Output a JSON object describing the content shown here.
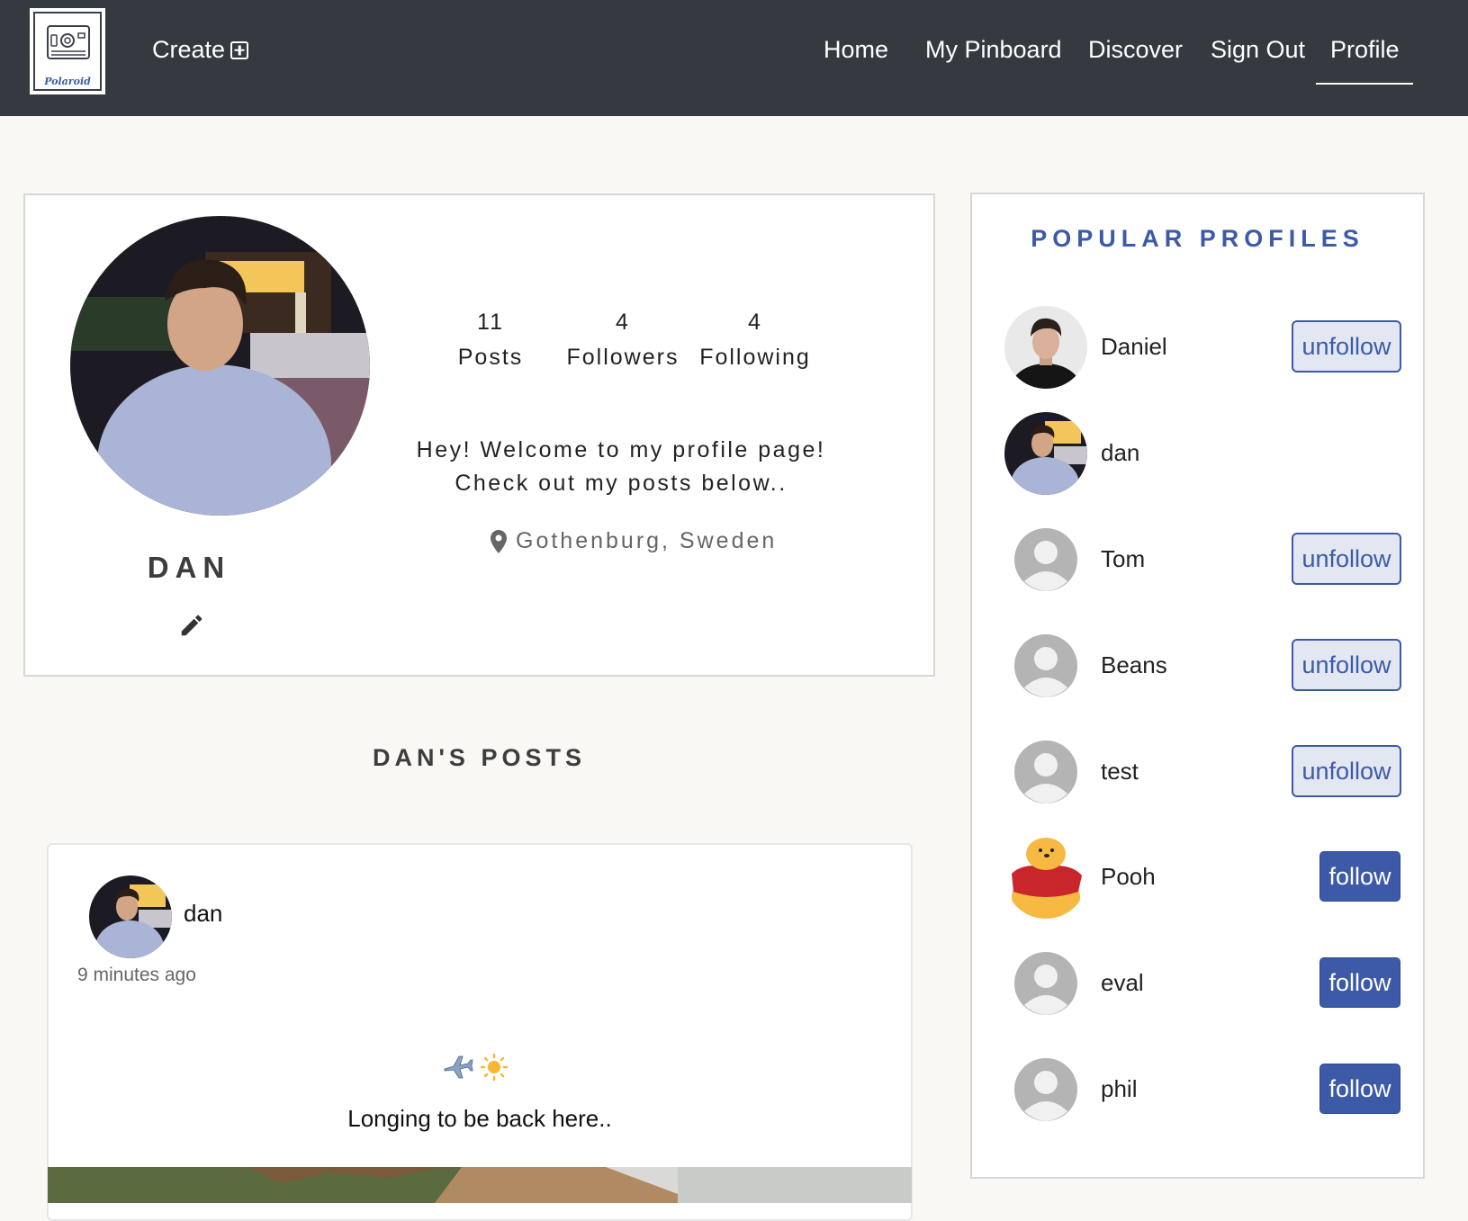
{
  "nav": {
    "logo_text": "Polaroid",
    "create_label": "Create",
    "links": [
      "Home",
      "My Pinboard",
      "Discover",
      "Sign Out",
      "Profile"
    ],
    "active": "Profile"
  },
  "profile": {
    "name": "DAN",
    "stats": [
      {
        "value": "11",
        "label": "Posts"
      },
      {
        "value": "4",
        "label": "Followers"
      },
      {
        "value": "4",
        "label": "Following"
      }
    ],
    "bio_line1": "Hey! Welcome to my profile page!",
    "bio_line2": "Check out my posts below..",
    "location": "Gothenburg, Sweden"
  },
  "posts_heading": "DAN'S POSTS",
  "post": {
    "author": "dan",
    "time": "9 minutes ago",
    "emoji": "✈️☀️",
    "text": "Longing to be back here.."
  },
  "popular": {
    "title": "POPULAR PROFILES",
    "profiles": [
      {
        "name": "Daniel",
        "action": "unfollow",
        "avatar": "photo-man"
      },
      {
        "name": "dan",
        "action": "",
        "avatar": "photo-dan"
      },
      {
        "name": "Tom",
        "action": "unfollow",
        "avatar": "default"
      },
      {
        "name": "Beans",
        "action": "unfollow",
        "avatar": "default"
      },
      {
        "name": "test",
        "action": "unfollow",
        "avatar": "default"
      },
      {
        "name": "Pooh",
        "action": "follow",
        "avatar": "pooh"
      },
      {
        "name": "eval",
        "action": "follow",
        "avatar": "default"
      },
      {
        "name": "phil",
        "action": "follow",
        "avatar": "default"
      }
    ]
  },
  "colors": {
    "navbar": "#343a40",
    "accent": "#3c5aa8",
    "background": "#f9f8f5"
  }
}
